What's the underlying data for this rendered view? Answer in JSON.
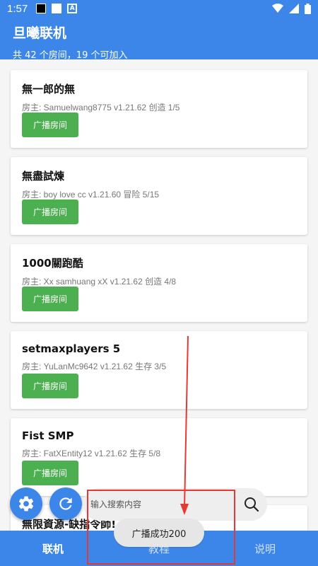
{
  "status_bar": {
    "time": "1:57"
  },
  "header": {
    "title": "旦曦联机",
    "subtitle": "共 42 个房间，19 个可加入"
  },
  "rooms": [
    {
      "name": "無一郎的無",
      "info": "房主: Samuelwang8775 v1.21.62 创造 1/5",
      "button": "广播房间"
    },
    {
      "name": "無盡試煉",
      "info": "房主: boy love cc v1.21.60 冒险 5/15",
      "button": "广播房间"
    },
    {
      "name": "1000關跑酷",
      "info": "房主: Xx samhuang xX v1.21.62 创造 4/8",
      "button": "广播房间"
    },
    {
      "name": "setmaxplayers 5",
      "info": "房主: YuLanMc9642 v1.21.62 生存 3/5",
      "button": "广播房间"
    },
    {
      "name": "Fist SMP",
      "info": "房主: FatXEntity12 v1.21.62 生存 5/8",
      "button": "广播房间"
    },
    {
      "name": "無限資源-缺指令師!",
      "info": "",
      "button": ""
    }
  ],
  "search": {
    "placeholder": "输入搜索内容"
  },
  "toast": {
    "text": "广播成功200"
  },
  "nav": {
    "tab1": "联机",
    "tab2": "教程",
    "tab3": "说明"
  },
  "colors": {
    "primary": "#3d86e9",
    "button_green": "#4caf50",
    "annotation_red": "#e53935"
  },
  "icons": [
    "settings-icon",
    "refresh-icon",
    "search-icon",
    "wifi-icon",
    "signal-icon",
    "battery-icon"
  ]
}
